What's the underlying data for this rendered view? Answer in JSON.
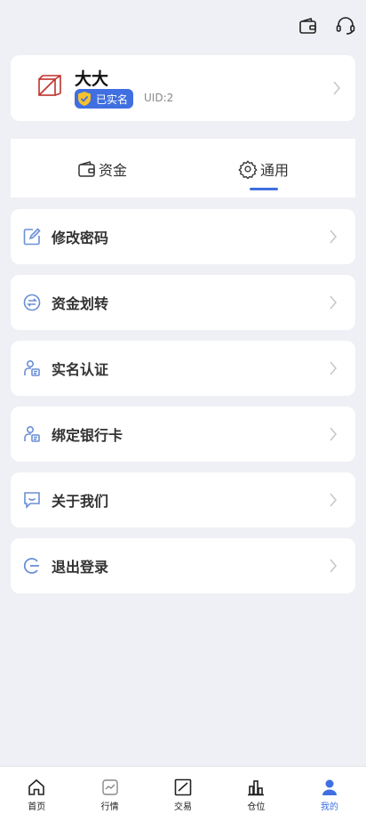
{
  "topbar": {
    "wallet_icon": "wallet-icon",
    "support_icon": "headset-icon"
  },
  "profile": {
    "name": "大大",
    "verified_label": "已实名",
    "uid": "UID:2"
  },
  "tabs": [
    {
      "label": "资金",
      "icon": "wallet-icon",
      "active": false
    },
    {
      "label": "通用",
      "icon": "gear-icon",
      "active": true
    }
  ],
  "menu": [
    {
      "label": "修改密码",
      "icon": "edit-icon"
    },
    {
      "label": "资金划转",
      "icon": "transfer-icon"
    },
    {
      "label": "实名认证",
      "icon": "id-user-icon"
    },
    {
      "label": "绑定银行卡",
      "icon": "id-user-icon"
    },
    {
      "label": "关于我们",
      "icon": "message-icon"
    },
    {
      "label": "退出登录",
      "icon": "logout-icon"
    }
  ],
  "nav": [
    {
      "label": "首页",
      "icon": "home-icon"
    },
    {
      "label": "行情",
      "icon": "market-icon"
    },
    {
      "label": "交易",
      "icon": "trade-icon"
    },
    {
      "label": "仓位",
      "icon": "chart-icon"
    },
    {
      "label": "我的",
      "icon": "user-icon",
      "active": true
    }
  ],
  "colors": {
    "accent": "#3f6fe0",
    "background": "#eef0f5",
    "icon_blue": "#6b8fd6"
  }
}
